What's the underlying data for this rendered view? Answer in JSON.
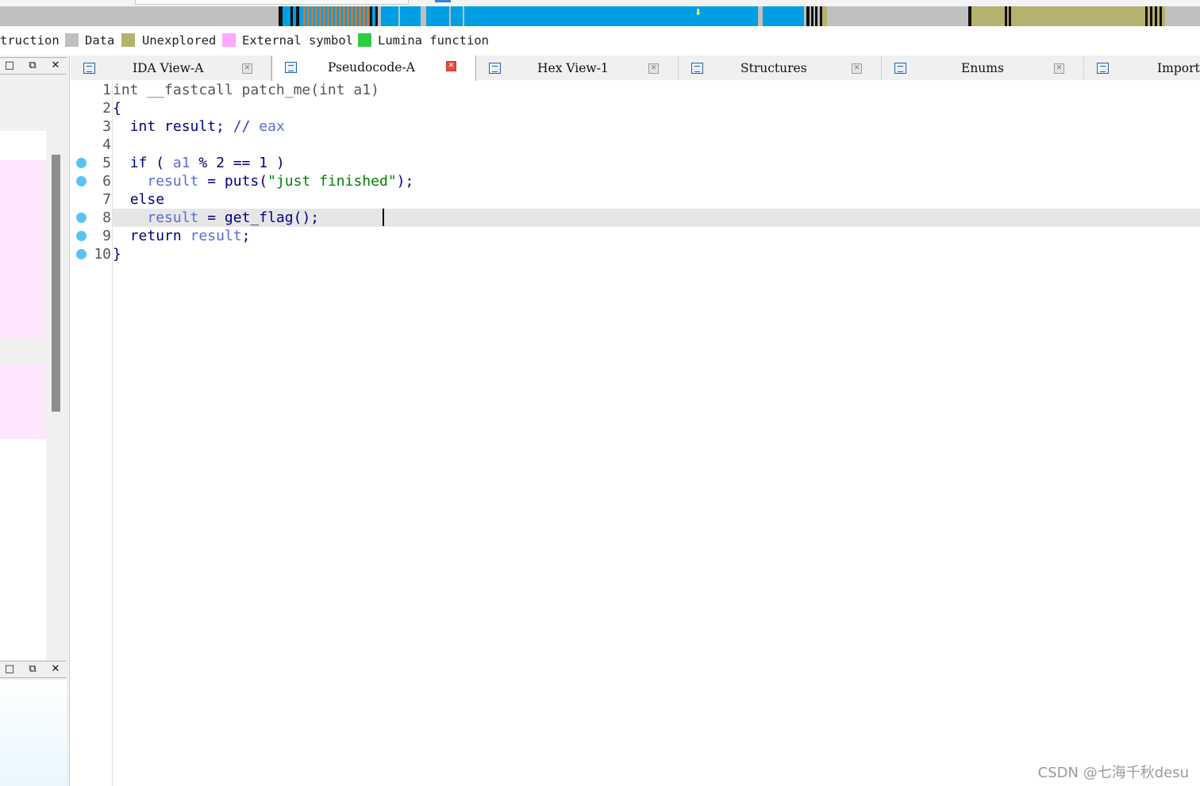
{
  "navband": {
    "colors": {
      "background": "#c0c0c0",
      "regular_function": "#009fe3",
      "instruction_black": "#111111",
      "library_orange": "#c37b3d",
      "unexplored": "#b5b16e",
      "cursor_arrow": "#f6ff6a"
    }
  },
  "legend": {
    "items": [
      {
        "label": "truction",
        "color": null
      },
      {
        "label": "Data",
        "color": "#c0c0c0"
      },
      {
        "label": "Unexplored",
        "color": "#b5b16e"
      },
      {
        "label": "External symbol",
        "color": "#ffa8ff"
      },
      {
        "label": "Lumina function",
        "color": "#2ecc40"
      }
    ]
  },
  "left_panel": {
    "top_buttons": [
      "□",
      "⧉",
      "✕"
    ],
    "bottom_buttons": [
      "□",
      "⧉",
      "✕"
    ]
  },
  "tabs": [
    {
      "label": "IDA View-A",
      "icon": "disassembly-icon",
      "active": false,
      "close": "✕"
    },
    {
      "label": "Pseudocode-A",
      "icon": "pseudocode-icon",
      "active": true,
      "close": "✕"
    },
    {
      "label": "Hex View-1",
      "icon": "hex-view-icon",
      "active": false,
      "close": "✕"
    },
    {
      "label": "Structures",
      "icon": "structures-icon",
      "active": false,
      "close": "✕"
    },
    {
      "label": "Enums",
      "icon": "enums-icon",
      "active": false,
      "close": "✕"
    },
    {
      "label": "Import",
      "icon": "imports-icon",
      "active": false
    }
  ],
  "code": {
    "lines": [
      {
        "num": "1",
        "breakpoint": false,
        "text": "int __fastcall patch_me(int a1)"
      },
      {
        "num": "2",
        "breakpoint": false,
        "text": "{"
      },
      {
        "num": "3",
        "breakpoint": false,
        "text": "  int result; // eax"
      },
      {
        "num": "4",
        "breakpoint": false,
        "text": ""
      },
      {
        "num": "5",
        "breakpoint": true,
        "text": "  if ( a1 % 2 == 1 )"
      },
      {
        "num": "6",
        "breakpoint": true,
        "text": "    result = puts(\"just finished\");"
      },
      {
        "num": "7",
        "breakpoint": false,
        "text": "  else"
      },
      {
        "num": "8",
        "breakpoint": true,
        "text": "    result = get_flag();"
      },
      {
        "num": "9",
        "breakpoint": true,
        "text": "  return result;"
      },
      {
        "num": "10",
        "breakpoint": true,
        "text": "}"
      }
    ],
    "current_line": "8",
    "colors": {
      "keyword": "#00007f",
      "variable": "#5c6bd8",
      "string": "#007f00",
      "comment": "#2a34d8",
      "gutter_text": "#555555",
      "breakpoint": "#58c3f7",
      "current_line_bg": "#e6e6e6"
    }
  },
  "tokens": {
    "l1_a": "int __fastcall patch_me(int a1)",
    "l2_a": "{",
    "l3_kw": "int",
    "l3_rest": " result;",
    "l3_cm": " // ",
    "l3_reg": "eax",
    "l5_if": "if ( ",
    "l5_var": "a1",
    "l5_rest": " % 2 == 1 )",
    "l6_var": "result",
    "l6_eq": " = ",
    "l6_fn": "puts",
    "l6_p1": "(",
    "l6_str": "\"just finished\"",
    "l6_p2": ");",
    "l7_else": "else",
    "l8_var": "result",
    "l8_eq": " = ",
    "l8_fn": "get_flag",
    "l8_rest": "();",
    "l9_ret": "return",
    "l9_sp": " ",
    "l9_var": "result",
    "l9_semi": ";",
    "l10_a": "}"
  },
  "watermark": "CSDN @七海千秋desu"
}
